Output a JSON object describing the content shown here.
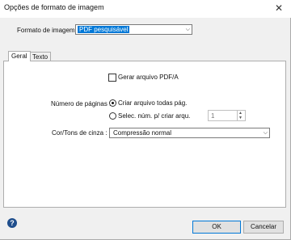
{
  "window": {
    "title": "Opções de formato de imagem",
    "close_glyph": "✕"
  },
  "format": {
    "label": "Formato de imagem :",
    "selected": "PDF pesquisável"
  },
  "tabs": [
    {
      "label": "Geral"
    },
    {
      "label": "Texto"
    }
  ],
  "general": {
    "generate_pdfa": {
      "label": "Gerar arquivo PDF/A",
      "checked": false
    },
    "page_count": {
      "label": "Número de páginas :",
      "option_all": "Criar arquivo todas pág.",
      "option_select": "Selec. núm. p/ criar arqu.",
      "selected": "all",
      "value": "1"
    },
    "color": {
      "label": "Cor/Tons de cinza :",
      "selected": "Compressão normal"
    }
  },
  "footer": {
    "help_glyph": "?",
    "ok_label": "OK",
    "cancel_label": "Cancelar"
  },
  "colors": {
    "accent": "#0078d7",
    "selection": "#0078d7",
    "help": "#1f4e8c"
  }
}
